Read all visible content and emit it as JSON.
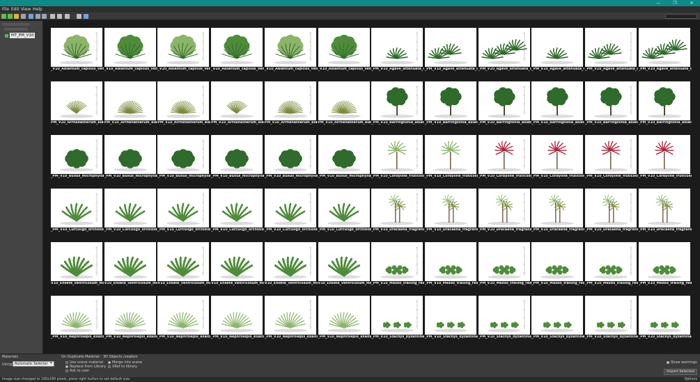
{
  "window": {
    "title": "MT_PM_V10",
    "controls": [
      "—",
      "❐",
      "✕"
    ]
  },
  "menu": [
    "File",
    "Edit",
    "View",
    "Help"
  ],
  "toolbar": {
    "icons": [
      {
        "name": "prev-icon",
        "color": "#5fbf4c"
      },
      {
        "name": "next-icon",
        "color": "#5fbf4c"
      },
      {
        "name": "up-folder-icon",
        "color": "#d9b548"
      },
      {
        "name": "list-view-icon",
        "color": "#9aa6b3"
      },
      {
        "name": "refresh-icon",
        "color": "#6fa7d8"
      },
      {
        "name": "filter-icon",
        "color": "#9aa6b3"
      },
      {
        "name": "sort-icon",
        "color": "#9aa6b3"
      },
      {
        "name": "zoom-in-icon",
        "color": "#bfbfbf"
      },
      {
        "name": "thumbnail-size-icon",
        "color": "#bfbfbf"
      },
      {
        "name": "grid-toggle-icon",
        "color": "#bfbfbf"
      },
      {
        "name": "zoom-out-icon",
        "color": "#bfbfbf"
      },
      {
        "name": "settings-icon",
        "color": "#6fa7d8"
      }
    ]
  },
  "tree": {
    "selected": "MT_PM_V10"
  },
  "grid": {
    "rows": [
      {
        "kind": "fern",
        "labels": [
          "_V10_Adiantum_capillus_veneris",
          "_V10_Adiantum_capillus_veneris",
          "_V10_Adiantum_capillus_veneris",
          "_V10_Adiantum_capillus_veneris",
          "_V10_Adiantum_capillus_veneris",
          "_V10_Adiantum_capillus_veneris",
          "_PM_V10_Agave_attenuata_01",
          "_PM_V10_Agave_attenuata_01",
          "_PM_V10_Agave_attenuata_01",
          "_PM_V10_Agave_attenuata_01",
          "_PM_V10_Agave_attenuata_01",
          "_PM_V10_Agave_attenuata_01"
        ]
      },
      {
        "kind": "grass",
        "labels": [
          "PM_V10_Arrhenatherum_elatius_0",
          "PM_V10_Arrhenatherum_elatius_0",
          "PM_V10_Arrhenatherum_elatius_0",
          "PM_V10_Arrhenatherum_elatius_0",
          "PM_V10_Arrhenatherum_elatius_0",
          "PM_V10_Arrhenatherum_elatius_0",
          "_PM_V10_Barringtonia_asiatica_01",
          "_PM_V10_Barringtonia_asiatica_01",
          "_PM_V10_Barringtonia_asiatica_01",
          "_PM_V10_Barringtonia_asiatica_01",
          "_PM_V10_Barringtonia_asiatica_01",
          "_PM_V10_Barringtonia_asiatica_01"
        ]
      },
      {
        "kind": "shrub",
        "labels": [
          "_PM_V10_Buxus_microphylla_01",
          "_PM_V10_Buxus_microphylla_01",
          "_PM_V10_Buxus_microphylla_01",
          "_PM_V10_Buxus_microphylla_01",
          "_PM_V10_Buxus_microphylla_01",
          "_PM_V10_Buxus_microphylla_01",
          "_PM_V10_Cordyline_fruticosa_01",
          "_PM_V10_Cordyline_fruticosa_01",
          "_PM_V10_Cordyline_fruticosa_01",
          "_PM_V10_Cordyline_fruticosa_01",
          "_PM_V10_Cordyline_fruticosa_01",
          "_PM_V10_Cordyline_fruticosa_01"
        ]
      },
      {
        "kind": "broadleaf",
        "labels": [
          "_PM_V10_Curculigo_orchioides_0",
          "_PM_V10_Curculigo_orchioides_0",
          "_PM_V10_Curculigo_orchioides_0",
          "_PM_V10_Curculigo_orchioides_0",
          "_PM_V10_Curculigo_orchioides_0",
          "_PM_V10_Curculigo_orchioides_0",
          "_PM_V10_Dracaena_fragrans_01",
          "_PM_V10_Dracaena_fragrans_01",
          "_PM_V10_Dracaena_fragrans_01",
          "_PM_V10_Dracaena_fragrans_01",
          "_PM_V10_Dracaena_fragrans_01",
          "_PM_V10_Dracaena_fragrans_01"
        ]
      },
      {
        "kind": "banana",
        "labels": [
          "V10_Ensete_ventricosum_maurel",
          "V10_Ensete_ventricosum_maurel",
          "V10_Ensete_ventricosum_maurel",
          "V10_Ensete_ventricosum_maurel",
          "V10_Ensete_ventricosum_maurel",
          "V10_Ensete_ventricosum_maurel",
          "_PM_V10_Mezoo_trailing_red_01",
          "_PM_V10_Mezoo_trailing_red_01",
          "_PM_V10_Mezoo_trailing_red_01",
          "_PM_V10_Mezoo_trailing_red_01",
          "_PM_V10_Mezoo_trailing_red_01",
          "_PM_V10_Mezoo_trailing_red_01"
        ]
      },
      {
        "kind": "nephrolepis",
        "labels": [
          "_PM_V10_Nephrolepis_exaltata_0",
          "_PM_V10_Nephrolepis_exaltata_0",
          "_PM_V10_Nephrolepis_exaltata_0",
          "_PM_V10_Nephrolepis_exaltata_0",
          "_PM_V10_Nephrolepis_exaltata_0",
          "_PM_V10_Nephrolepis_exaltata_0",
          "_PM_V10_Stachys_byzantina_01",
          "_PM_V10_Stachys_byzantina_01",
          "_PM_V10_Stachys_byzantina_01",
          "_PM_V10_Stachys_byzantina_01",
          "_PM_V10_Stachys_byzantina_01",
          "_PM_V10_Stachys_byzantina_01"
        ]
      }
    ],
    "second_kinds": [
      "agave",
      "tree",
      "cordyline",
      "dracaena",
      "mezoo",
      "stachys"
    ],
    "leaf_colors": {
      "dark_green": "#2f6b2a",
      "green": "#4f8c3a",
      "light_green": "#8db56a",
      "red": "#b0263a",
      "olive": "#7a8c3a"
    }
  },
  "bottom": {
    "materials_label": "Materials",
    "using_label": "Using:",
    "using_value": "Automatic Selector",
    "on_duplicate_label": "On Duplicate Material:",
    "dup_options": [
      "Use scene material",
      "Replace from Library",
      "Ask to user"
    ],
    "dup_selected": 1,
    "objects_label": "3D Objects creation",
    "obj_options": [
      "Merge into scene",
      "XRef to library"
    ],
    "obj_selected": 0,
    "show_warnings": "Show warnings",
    "import_button": "Import Selected"
  },
  "status": {
    "text": "Image size changed to 180x180 pixels, press right button to set default size.",
    "right": "Options"
  }
}
